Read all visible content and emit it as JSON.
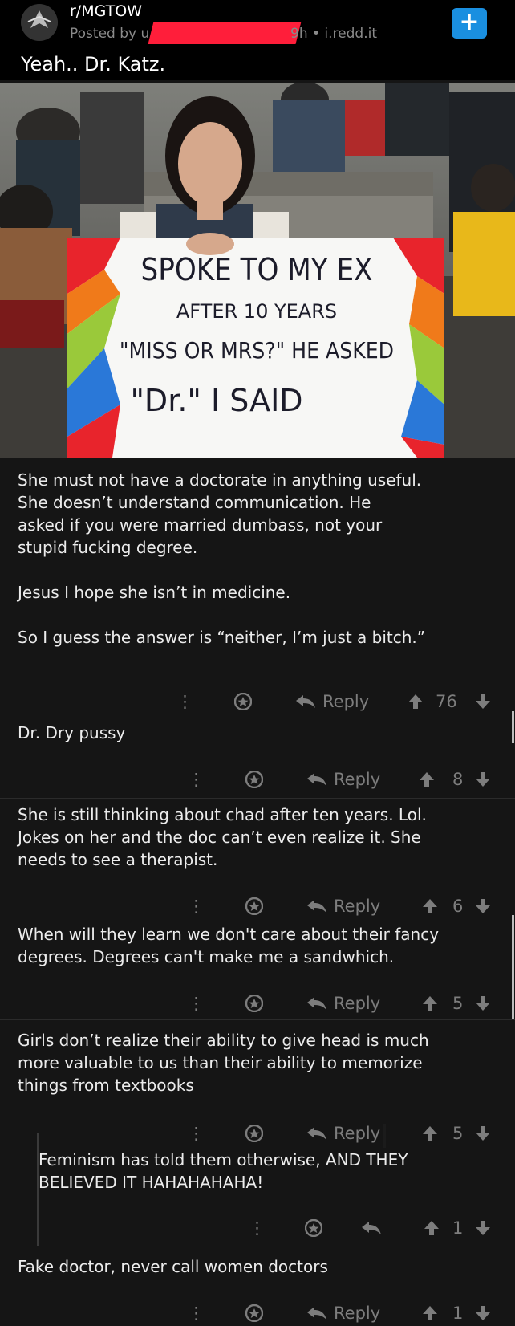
{
  "post": {
    "subreddit": "r/MGTOW",
    "posted_by_prefix": "Posted by u/s",
    "age_domain": "9h • i.redd.it",
    "title": "Yeah.. Dr. Katz.",
    "join_icon": "plus-icon",
    "sign_text": {
      "line1": "SPOKE TO MY EX",
      "line2": "AFTER 10 YEARS",
      "line3": "\"MISS OR MRS?\" HE ASKED",
      "line4": "\"Dr.\" I SAID"
    }
  },
  "comments": [
    {
      "text": "She must not have a doctorate in anything useful.\nShe doesn’t understand communication.  He\nasked if you were married dumbass, not your\nstupid fucking degree.\n\nJesus I hope she isn’t in medicine.\n\nSo I guess the answer is “neither, I’m just a bitch.”",
      "reply": "Reply",
      "score": "76"
    },
    {
      "text": "Dr. Dry pussy",
      "reply": "Reply",
      "score": "8"
    },
    {
      "text": "She is still thinking about chad after ten years. Lol.\nJokes on her and the doc can’t even realize it. She\nneeds to see a therapist.",
      "reply": "Reply",
      "score": "6"
    },
    {
      "text": "When will they learn we don't care about their fancy\ndegrees. Degrees can't make me a sandwhich.",
      "reply": "Reply",
      "score": "5"
    },
    {
      "text": "Girls don’t realize their ability to give head is much\nmore valuable to us than their ability to memorize\nthings from textbooks",
      "reply": "Reply",
      "score": "5"
    },
    {
      "text": "Feminism has told them otherwise, AND THEY\nBELIEVED IT HAHAHAHAHA!",
      "reply": "",
      "score": "1"
    },
    {
      "text": "Fake doctor, never call women doctors",
      "reply": "Reply",
      "score": "1"
    }
  ],
  "icons": {
    "more": "more-vertical-icon",
    "award": "award-icon",
    "reply": "reply-arrow-icon",
    "upvote": "upvote-arrow-icon",
    "downvote": "downvote-arrow-icon"
  },
  "colors": {
    "background": "#151515",
    "header": "#000000",
    "accent": "#1a8fe0",
    "redaction": "#ff1e3a",
    "muted": "#7d7d7d"
  }
}
